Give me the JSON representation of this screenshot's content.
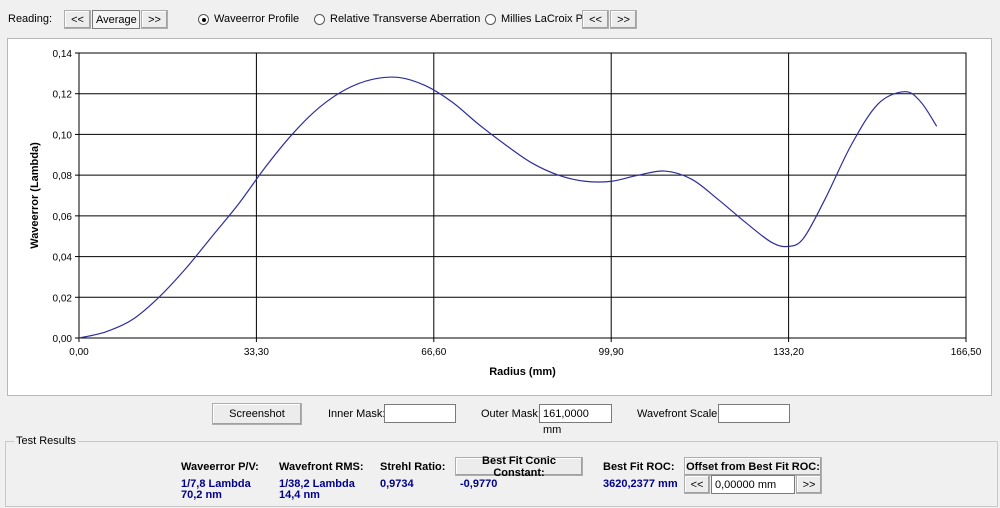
{
  "toolbar": {
    "reading_label": "Reading:",
    "prev_label": "<<",
    "reading_value": "Average",
    "next_label": ">>",
    "modes": [
      {
        "label": "Waveerror Profile",
        "selected": true
      },
      {
        "label": "Relative Transverse Aberration",
        "selected": false
      },
      {
        "label": "Millies LaCroix Plot",
        "selected": false
      }
    ],
    "plot_prev_label": "<<",
    "plot_next_label": ">>"
  },
  "chart_data": {
    "type": "line",
    "xlabel": "Radius (mm)",
    "ylabel": "Waveerror (Lambda)",
    "xlim": [
      0,
      166.5
    ],
    "ylim": [
      0,
      0.14
    ],
    "x_ticks": [
      "0,00",
      "33,30",
      "66,60",
      "99,90",
      "133,20",
      "166,50"
    ],
    "y_ticks": [
      "0,00",
      "0,02",
      "0,04",
      "0,06",
      "0,08",
      "0,10",
      "0,12",
      "0,14"
    ],
    "grid": true,
    "series": [
      {
        "color": "#2e2e9e",
        "x": [
          0,
          5,
          10,
          15,
          20,
          25,
          30,
          35,
          40,
          45,
          50,
          55,
          60,
          65,
          70,
          75,
          80,
          85,
          90,
          95,
          100,
          105,
          110,
          115,
          120,
          125,
          130,
          133.2,
          136,
          140,
          145,
          150,
          155,
          158,
          161
        ],
        "y": [
          0,
          0.003,
          0.009,
          0.02,
          0.034,
          0.05,
          0.066,
          0.084,
          0.1,
          0.113,
          0.122,
          0.127,
          0.128,
          0.124,
          0.116,
          0.105,
          0.095,
          0.086,
          0.08,
          0.077,
          0.077,
          0.08,
          0.082,
          0.078,
          0.068,
          0.057,
          0.047,
          0.045,
          0.049,
          0.068,
          0.095,
          0.115,
          0.121,
          0.116,
          0.104
        ]
      }
    ]
  },
  "controls": {
    "screenshot_label": "Screenshot",
    "inner_mask_label": "Inner Mask:",
    "inner_mask_value": "",
    "outer_mask_label": "Outer Mask:",
    "outer_mask_value": "161,0000 mm",
    "wavefront_scale_label": "Wavefront Scale:",
    "wavefront_scale_value": ""
  },
  "results": {
    "group_title": "Test Results",
    "pv_label": "Waveerror P/V:",
    "pv_lambda": "1/7,8 Lambda",
    "pv_nm": "70,2 nm",
    "rms_label": "Wavefront RMS:",
    "rms_lambda": "1/38,2 Lambda",
    "rms_nm": "14,4 nm",
    "strehl_label": "Strehl Ratio:",
    "strehl_value": "0,9734",
    "conic_button": "Best Fit Conic Constant:",
    "conic_value": "-0,9770",
    "roc_label": "Best Fit ROC:",
    "roc_value": "3620,2377 mm",
    "offset_button": "Offset from Best Fit ROC:",
    "offset_prev": "<<",
    "offset_value": "0,00000 mm",
    "offset_next": ">>"
  }
}
